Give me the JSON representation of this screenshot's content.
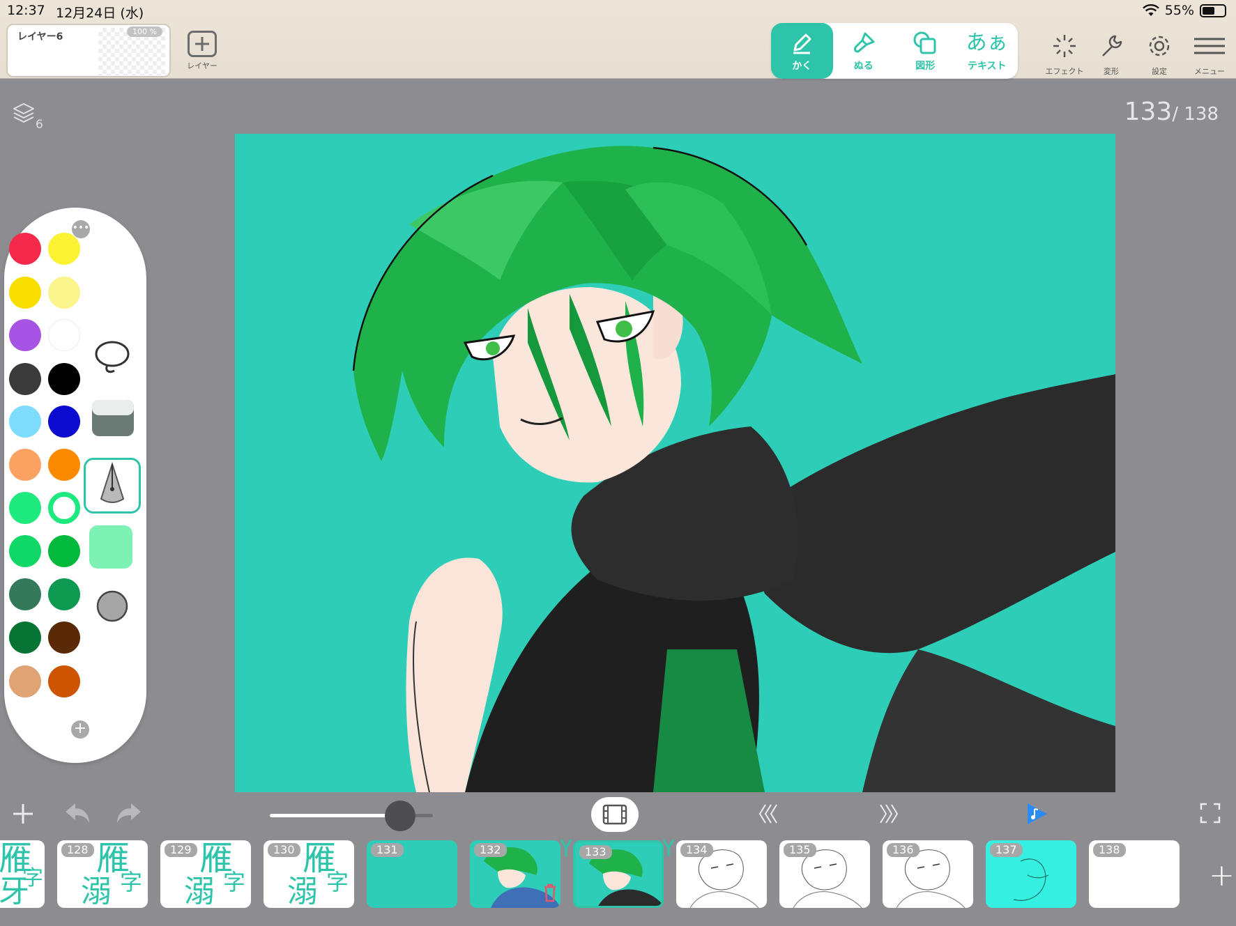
{
  "status": {
    "time": "12:37",
    "date": "12月24日 (水)",
    "battery": "55%",
    "battery_level": 0.55
  },
  "layer_panel": {
    "name": "レイヤー6",
    "opacity": "100 %"
  },
  "add_layer": {
    "label": "レイヤー"
  },
  "tools": [
    {
      "label": "かく",
      "icon": "pencil-icon",
      "active": true
    },
    {
      "label": "ぬる",
      "icon": "paint-brush-icon",
      "active": false
    },
    {
      "label": "図形",
      "icon": "shapes-icon",
      "active": false
    },
    {
      "label": "テキスト",
      "glyph": "あぁ",
      "icon": "text-icon",
      "active": false
    }
  ],
  "right_tools": [
    {
      "label": "エフェクト",
      "icon": "sparkle-icon"
    },
    {
      "label": "変形",
      "icon": "wrench-icon"
    },
    {
      "label": "設定",
      "icon": "gear-icon"
    },
    {
      "label": "メニュー",
      "icon": "hamburger-menu-icon"
    }
  ],
  "canvas": {
    "layer_count": "6",
    "current_frame": "133",
    "total_frames": "/ 138",
    "background": "#2ecdb7"
  },
  "palette": {
    "colors": [
      [
        "#f5294b",
        "#faf233"
      ],
      [
        "#f9df00",
        "#f9f48c"
      ],
      [
        "#a754e4",
        "#ffffff"
      ],
      [
        "#3b3b3b",
        "#000000"
      ],
      [
        "#7ddcfb",
        "#0c0cd1"
      ],
      [
        "#f9a261",
        "#fb8a00"
      ],
      [
        "#1ee97f",
        "#1ee97f"
      ],
      [
        "#10d866",
        "#03b93b"
      ],
      [
        "#35795b",
        "#0d9a50"
      ],
      [
        "#087433",
        "#5a2a08"
      ],
      [
        "#e0a373",
        "#cc5402"
      ]
    ],
    "brush_size_color": "#7ef1b4"
  },
  "controls": {
    "zoom_level": 0.8
  },
  "timeline": {
    "frames": [
      {
        "num": "",
        "type": "kanji"
      },
      {
        "num": "128",
        "type": "kanji"
      },
      {
        "num": "129",
        "type": "kanji"
      },
      {
        "num": "130",
        "type": "kanji"
      },
      {
        "num": "131",
        "type": "teal"
      },
      {
        "num": "132",
        "type": "art"
      },
      {
        "num": "133",
        "type": "art-current"
      },
      {
        "num": "134",
        "type": "sketch"
      },
      {
        "num": "135",
        "type": "sketch"
      },
      {
        "num": "136",
        "type": "sketch"
      },
      {
        "num": "137",
        "type": "cyan"
      },
      {
        "num": "138",
        "type": "blank"
      }
    ],
    "kanji": {
      "top": "雁",
      "left": "溺",
      "right": "字",
      "partial_top": "雁",
      "partial_bottom": "牙",
      "partial_right": "字"
    }
  }
}
